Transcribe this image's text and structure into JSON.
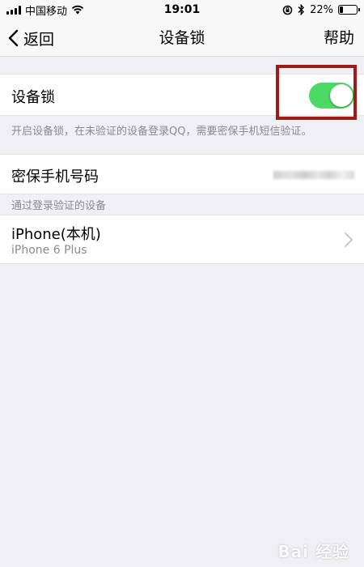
{
  "status_bar": {
    "carrier": "中国移动",
    "time": "19:01",
    "battery_percent": "22%",
    "battery_level": 0.22
  },
  "nav": {
    "back_label": "返回",
    "title": "设备锁",
    "help_label": "帮助"
  },
  "device_lock": {
    "label": "设备锁",
    "enabled": true,
    "description": "开启设备锁，在未验证的设备登录QQ，需要密保手机短信验证。"
  },
  "security_phone": {
    "label": "密保手机号码"
  },
  "verified_devices": {
    "section_title": "通过登录验证的设备",
    "items": [
      {
        "name": "iPhone(本机)",
        "model": "iPhone 6 Plus"
      }
    ]
  },
  "colors": {
    "toggle_on": "#4cd964",
    "highlight": "#a11a1a",
    "background": "#efeff4"
  },
  "watermark": "Bai 经验"
}
